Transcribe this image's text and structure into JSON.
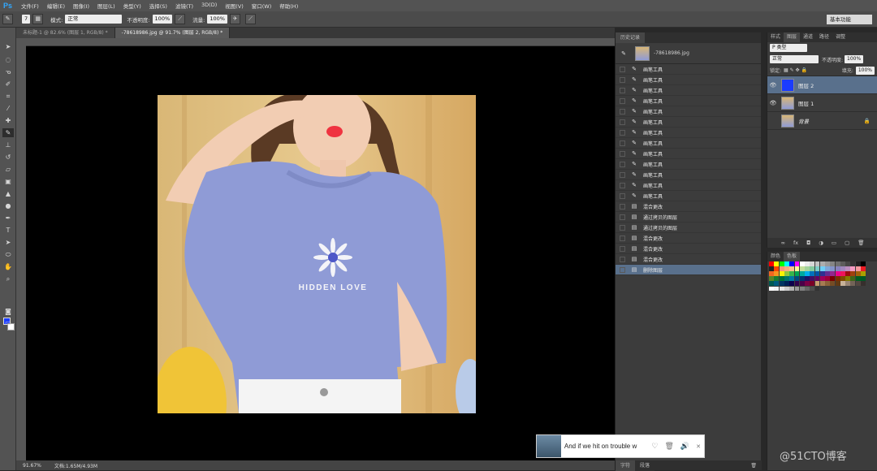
{
  "app": {
    "logo": "Ps"
  },
  "menubar": {
    "items": [
      "文件(F)",
      "编辑(E)",
      "图像(I)",
      "图层(L)",
      "类型(Y)",
      "选择(S)",
      "滤镜(T)",
      "3D(D)",
      "视图(V)",
      "窗口(W)",
      "帮助(H)"
    ]
  },
  "options": {
    "brush_size": "7",
    "mode_label": "模式:",
    "mode_value": "正常",
    "opacity_label": "不透明度:",
    "opacity_value": "100%",
    "flow_label": "流量:",
    "flow_value": "100%",
    "workspace": "基本功能"
  },
  "tabs": [
    {
      "label": "未标题-1 @ 82.6% (图层 1, RGB/8) *",
      "active": false
    },
    {
      "label": "-78618986.jpg @ 91.7% (图层 2, RGB/8) *",
      "active": true
    }
  ],
  "canvas": {
    "image_text": "HIDDEN LOVE",
    "accent": "#8f9bd6"
  },
  "status": {
    "zoom": "91.67%",
    "doc_info": "文档:1.65M/4.93M"
  },
  "history": {
    "tabs": [
      "历史记录"
    ],
    "snapshot_label": "-78618986.jpg",
    "items": [
      {
        "label": "画笔工具",
        "icon": "brush-icon"
      },
      {
        "label": "画笔工具",
        "icon": "brush-icon"
      },
      {
        "label": "画笔工具",
        "icon": "brush-icon"
      },
      {
        "label": "画笔工具",
        "icon": "brush-icon"
      },
      {
        "label": "画笔工具",
        "icon": "brush-icon"
      },
      {
        "label": "画笔工具",
        "icon": "brush-icon"
      },
      {
        "label": "画笔工具",
        "icon": "brush-icon"
      },
      {
        "label": "画笔工具",
        "icon": "brush-icon"
      },
      {
        "label": "画笔工具",
        "icon": "brush-icon"
      },
      {
        "label": "画笔工具",
        "icon": "brush-icon"
      },
      {
        "label": "画笔工具",
        "icon": "brush-icon"
      },
      {
        "label": "画笔工具",
        "icon": "brush-icon"
      },
      {
        "label": "画笔工具",
        "icon": "brush-icon"
      },
      {
        "label": "混合更改",
        "icon": "layer-icon"
      },
      {
        "label": "通过拷贝的图层",
        "icon": "layer-icon"
      },
      {
        "label": "通过拷贝的图层",
        "icon": "layer-icon"
      },
      {
        "label": "混合更改",
        "icon": "layer-icon"
      },
      {
        "label": "混合更改",
        "icon": "layer-icon"
      },
      {
        "label": "混合更改",
        "icon": "layer-icon"
      },
      {
        "label": "删除图层",
        "icon": "layer-icon",
        "selected": true
      }
    ],
    "footer_tabs": [
      "字符",
      "段落"
    ]
  },
  "layers": {
    "tabs": [
      "样式",
      "图层",
      "通道",
      "路径",
      "调整"
    ],
    "filter_label": "P 类型",
    "blend_mode": "正常",
    "opacity_label": "不透明度:",
    "opacity_value": "100%",
    "lock_label": "锁定:",
    "fill_label": "填充:",
    "fill_value": "100%",
    "items": [
      {
        "name": "图层 2",
        "selected": true,
        "visible": true
      },
      {
        "name": "图层 1",
        "selected": false,
        "visible": true
      },
      {
        "name": "背景",
        "selected": false,
        "visible": false,
        "locked": true
      }
    ]
  },
  "swatches": {
    "tabs": [
      "颜色",
      "色板"
    ]
  },
  "music_widget": {
    "title": "And if we hit on trouble w"
  },
  "watermark": "@51CTO博客"
}
